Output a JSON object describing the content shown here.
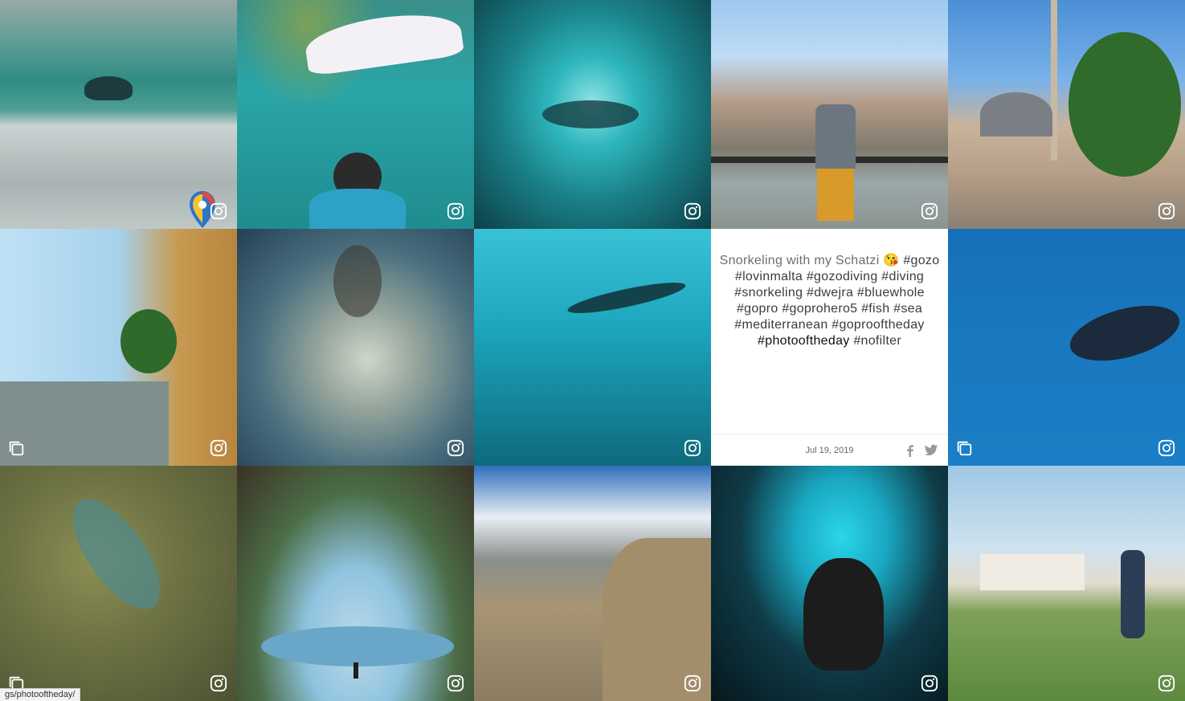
{
  "post_text": {
    "caption_plain": "Snorkeling with my Schatzi 😘",
    "caption_tags": "#gozo #lovinmalta #gozodiving #diving #snorkeling #dwejra #bluewhole #gopro #goprohero5 #fish #sea #mediterranean #goprooftheday",
    "caption_strong": "#photooftheday",
    "caption_tail": "#nofilter",
    "date": "Jul 19, 2019"
  },
  "icons": {
    "instagram": "instagram-icon",
    "multi": "multiple-images-icon",
    "facebook": "facebook-icon",
    "twitter": "twitter-icon",
    "location_pin": "location-pin-icon"
  },
  "status_bar_url": "gs/photooftheday/"
}
